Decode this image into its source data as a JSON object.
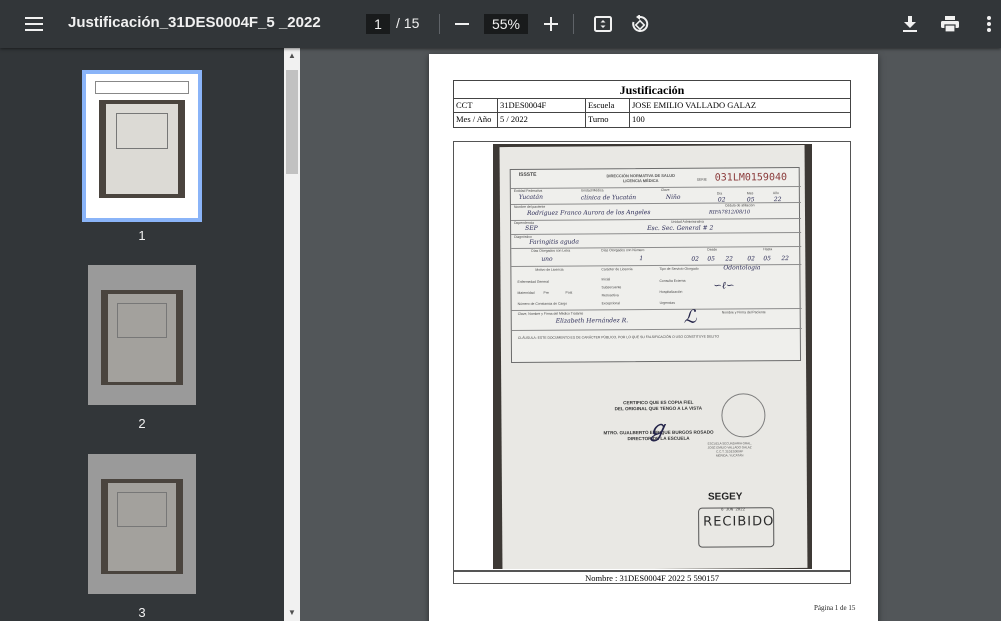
{
  "toolbar": {
    "title": "Justificación_31DES0004F_5 _2022",
    "current_page": "1",
    "total_pages": "/ 15",
    "zoom": "55%"
  },
  "thumbnails": [
    {
      "number": "1",
      "selected": true
    },
    {
      "number": "2",
      "selected": false
    },
    {
      "number": "3",
      "selected": false
    }
  ],
  "document": {
    "title": "Justificación",
    "rows": [
      {
        "l1": "CCT",
        "v1": "31DES0004F",
        "l2": "Escuela",
        "v2": "JOSE EMILIO VALLADO GALAZ"
      },
      {
        "l1": "Mes / Año",
        "v1": "5 / 2022",
        "l2": "Turno",
        "v2": "100"
      }
    ],
    "footer": "Nombre : 31DES0004F 2022 5 590157",
    "page_label": "Página 1 de 15"
  },
  "scan": {
    "agency": "ISSSTE",
    "form_header": "DIRECCIÓN NORMATIVA DE SALUD\nLICENCIA MÉDICA",
    "serie_label": "SERIE",
    "serie": "031LM0159040",
    "labels": {
      "entidad": "Entidad Federativa",
      "unidad": "Unidad Médica",
      "clave": "Clave",
      "dia": "Día",
      "mes": "Mes",
      "anio": "Año",
      "nombre": "Nombre del paciente",
      "cedula": "Cédula de afiliación",
      "dependencia": "Dependencia",
      "unidad_adscripcion": "Unidad Administrativa",
      "diagnostico": "Diagnóstico",
      "dias_letra": "Días Otorgados con Letra",
      "dias_num": "Días Otorgados con Número",
      "desde": "Desde",
      "hasta": "Hasta",
      "motivo": "Motivo de Licencia",
      "caracter": "Carácter de Licencia",
      "tipo_servicio": "Tipo de Servicio Otorgado",
      "enfermedad": "Enfermedad General",
      "maternidad": "Maternidad",
      "pre": "Pre",
      "post": "Post",
      "inicial": "Inicial",
      "subsecuente": "Subsecuente",
      "retroactiva": "Retroactiva",
      "excepcional": "Excepcional",
      "consulta": "Consulta Externa",
      "hospitalizacion": "Hospitalización",
      "urgencias": "Urgencias",
      "num_constancia": "Número de Constancia de Cargo",
      "medico": "Clave, Nombre y Firma del Médico Tratante",
      "paciente_firma": "Nombre y Firma del Paciente"
    },
    "handwriting": {
      "entidad": "Yucatán",
      "unidad": "clínica de Yucatán",
      "clave": "Niño",
      "dia": "02",
      "mes": "05",
      "anio": "22",
      "nombre": "Rodriguez Franco Aurora de los Angeles",
      "cedula": "RIFA7812/08/10",
      "dependencia": "SEP",
      "unidad_adscripcion": "Esc. Sec. General # 2",
      "diagnostico": "Faringitis aguda",
      "dias_letra": "uno",
      "dias_num": "1",
      "desde_d": "02",
      "desde_m": "05",
      "desde_a": "22",
      "hasta_d": "02",
      "hasta_m": "05",
      "hasta_a": "22",
      "servicio": "Odontología",
      "medico": "Elizabeth Hernández R."
    },
    "notice": "CLÁUSULA: ESTE DOCUMENTO ES DE CARÁCTER PÚBLICO, POR LO QUE SU FALSIFICACIÓN O USO CONSTITUYE DELITO",
    "cert_text": [
      "CERTIFICO QUE ES COPIA FIEL",
      "DEL ORIGINAL QUE TENGO A LA VISTA"
    ],
    "director_name": "MTRO. GUALBERTO ENRIQUE BURGOS ROSADO",
    "director_title": "DIRECTOR DE LA ESCUELA",
    "stamp_lines": [
      "ESCUELA SECUNDARIA GRAL.",
      "JOSÉ EMILIO VALLADO GALAZ",
      "C.C.T. 31DES0004F",
      "MÉRIDA, YUCATÁN"
    ],
    "segey": "SEGEY",
    "recibido": "RECIBIDO",
    "date_stamp": "6 JUN 2022"
  }
}
